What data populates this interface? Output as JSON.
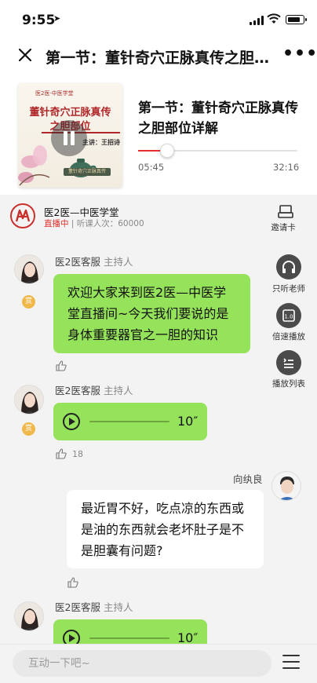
{
  "status_bar": {
    "time": "9:55"
  },
  "nav": {
    "title": "第一节：董针奇穴正脉真传之胆部位详解"
  },
  "player": {
    "lesson_title": "第一节：董针奇穴正脉真传之胆部位详解",
    "current_time": "05:45",
    "total_time": "32:16",
    "progress_fraction": 0.18,
    "cover": {
      "logo_text": "医2医·中医学堂",
      "title_line1": "董针奇穴正脉真传",
      "title_line2": "之胆部位",
      "speaker": "主讲：王招诗",
      "footer": "董针奇穴正脉真传"
    }
  },
  "host": {
    "name": "医2医—中医学堂",
    "live_label": "直播中",
    "listeners": "| 听课人次：60000",
    "invite_label": "邀请卡"
  },
  "side_actions": [
    {
      "label": "只听老师",
      "icon": "headphones-icon"
    },
    {
      "label": "倍速播放",
      "icon": "speed-icon",
      "badge": "1.0"
    },
    {
      "label": "播放列表",
      "icon": "playlist-icon"
    }
  ],
  "messages": [
    {
      "sender": "医2医客服",
      "role": "主持人",
      "reward": "赏",
      "text": "欢迎大家来到医2医—中医学堂直播间~今天我们要说的是身体重要器官之一胆的知识",
      "likes": ""
    },
    {
      "sender": "医2医客服",
      "role": "主持人",
      "reward": "赏",
      "duration": "10″",
      "likes": "18"
    },
    {
      "sender": "向纨良",
      "text": "最近胃不好，吃点凉的东西或是油的东西就会老坏肚子是不是胆囊有问题?"
    },
    {
      "sender": "医2医客服",
      "role": "主持人",
      "duration": "10″"
    }
  ],
  "bottom": {
    "input_placeholder": "互动一下吧~"
  },
  "colors": {
    "accent_red": "#e3302c",
    "bubble_green": "#95e25b",
    "background": "#f3f3f3"
  }
}
